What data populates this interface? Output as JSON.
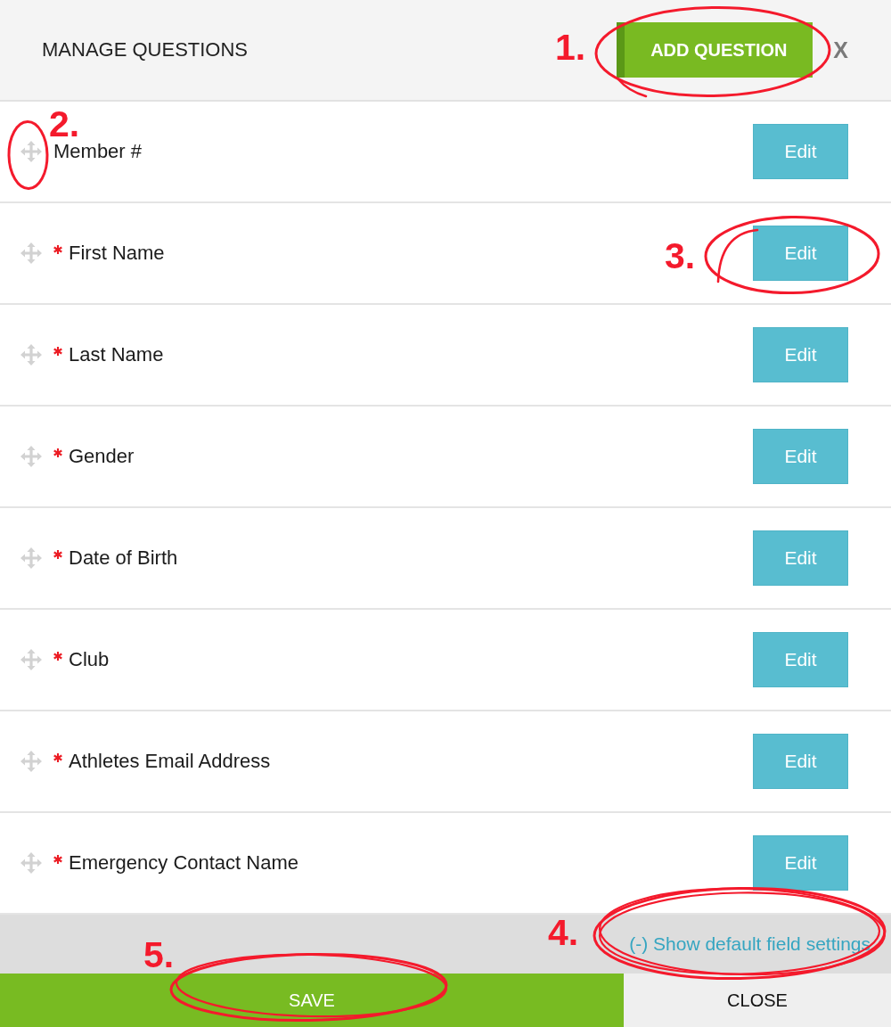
{
  "header": {
    "title": "MANAGE QUESTIONS",
    "add_button": {
      "label": "ADD QUESTION",
      "annotation": "1."
    },
    "close_button": "X"
  },
  "questions": [
    {
      "label": "Member #",
      "required": false,
      "edit_button": "Edit",
      "handle_annotation": "2."
    },
    {
      "label": "First Name",
      "required": true,
      "edit_button": "Edit",
      "edit_annotation": "3."
    },
    {
      "label": "Last Name",
      "required": true,
      "edit_button": "Edit"
    },
    {
      "label": "Gender",
      "required": true,
      "edit_button": "Edit"
    },
    {
      "label": "Date of Birth",
      "required": true,
      "edit_button": "Edit"
    },
    {
      "label": "Club",
      "required": true,
      "edit_button": "Edit"
    },
    {
      "label": "Athletes Email Address",
      "required": true,
      "edit_button": "Edit"
    },
    {
      "label": "Emergency Contact Name",
      "required": true,
      "edit_button": "Edit"
    }
  ],
  "settings_link": {
    "label": "(-) Show default field settings",
    "annotation": "4."
  },
  "footer": {
    "save_button": {
      "label": "SAVE",
      "annotation": "5."
    },
    "close_button": {
      "label": "CLOSE"
    }
  }
}
